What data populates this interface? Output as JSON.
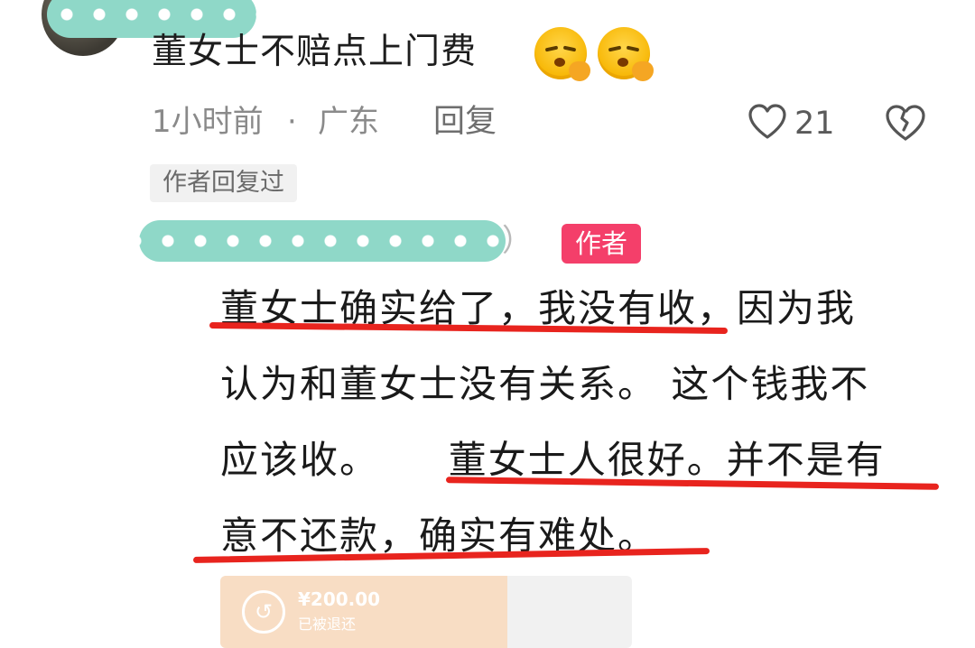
{
  "comment": {
    "text": "董女士不赔点上门费",
    "emojis": [
      "shushing-face",
      "shushing-face"
    ],
    "time": "1小时前",
    "separator": "·",
    "location": "广东",
    "reply_label": "回复",
    "like_count": "21",
    "author_replied_tag": "作者回复过"
  },
  "reply": {
    "author_suffix": "）",
    "author_badge": "作者",
    "lines": [
      "董女士确实给了，我没有收，因为我",
      "认为和董女士没有关系。 这个钱我不",
      "应该收。     董女士人很好。并不是有",
      "意不还款，确实有难处。"
    ],
    "transfer_card": {
      "amount": "¥200.00",
      "status": "已被退还"
    }
  },
  "colors": {
    "underline": "#e8241e",
    "author_badge_bg": "#f43f6a",
    "scribble": "#8fd8c8",
    "card_left": "#f8ddc4"
  }
}
